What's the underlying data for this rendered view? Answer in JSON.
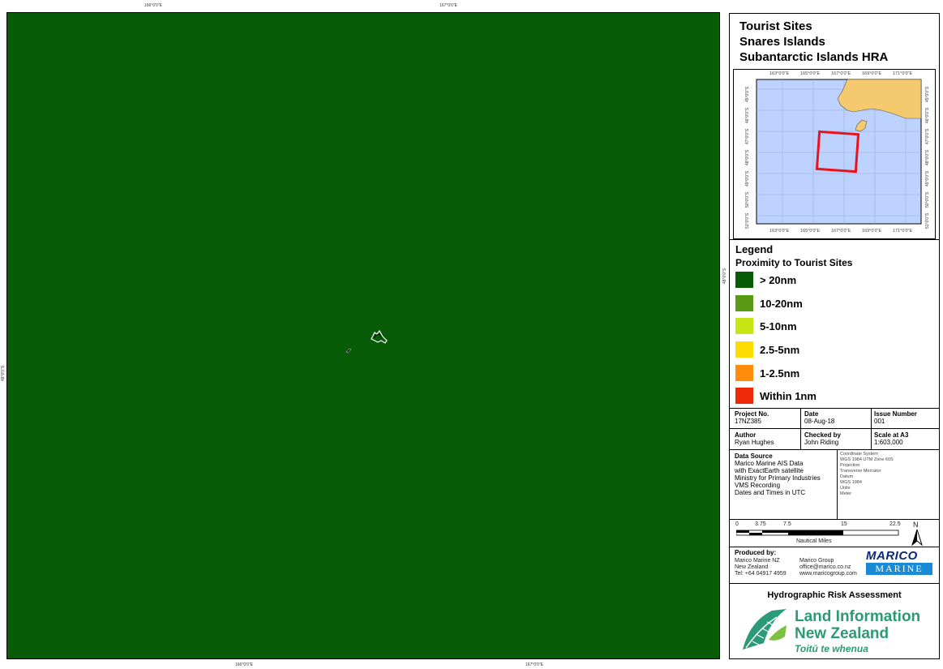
{
  "map": {
    "top_ticks": [
      "166°0'0\"E",
      "167°0'0\"E"
    ],
    "bottom_ticks": [
      "166°0'0\"E",
      "167°0'0\"E"
    ],
    "left_tick": "48°0'0\"S",
    "right_tick": "48°0'0\"S",
    "background_color": "#085c08"
  },
  "title": {
    "line1": "Tourist Sites",
    "line2": "Snares Islands",
    "line3": "Subantarctic Islands HRA"
  },
  "inset": {
    "top_ticks": [
      "163°0'0\"E",
      "165°0'0\"E",
      "167°0'0\"E",
      "169°0'0\"E",
      "171°0'0\"E"
    ],
    "bottom_ticks": [
      "163°0'0\"E",
      "165°0'0\"E",
      "167°0'0\"E",
      "169°0'0\"E",
      "171°0'0\"E"
    ],
    "left_ticks": [
      "45°0'0\"S",
      "46°0'0\"S",
      "47°0'0\"S",
      "48°0'0\"S",
      "49°0'0\"S",
      "50°0'0\"S",
      "51°0'0\"S"
    ],
    "right_ticks": [
      "45°0'0\"S",
      "46°0'0\"S",
      "47°0'0\"S",
      "48°0'0\"S",
      "49°0'0\"S",
      "50°0'0\"S",
      "51°0'0\"S"
    ],
    "sea_color": "#bed2ff",
    "land_color": "#f5c96e",
    "extent_color": "#e8141c"
  },
  "legend": {
    "title": "Legend",
    "subtitle": "Proximity to Tourist Sites",
    "items": [
      {
        "label": "> 20nm",
        "color": "#085c08"
      },
      {
        "label": "10-20nm",
        "color": "#5a9a14"
      },
      {
        "label": "5-10nm",
        "color": "#c8e614"
      },
      {
        "label": "2.5-5nm",
        "color": "#ffdc00"
      },
      {
        "label": "1-2.5nm",
        "color": "#ff8c0a"
      },
      {
        "label": "Within 1nm",
        "color": "#f0280a"
      }
    ]
  },
  "info": {
    "project_no_label": "Project No.",
    "project_no": "17NZ385",
    "date_label": "Date",
    "date": "08-Aug-18",
    "issue_label": "Issue Number",
    "issue": "001",
    "author_label": "Author",
    "author": "Ryan Hughes",
    "checked_label": "Checked by",
    "checked": "John Riding",
    "scale_label": "Scale at A3",
    "scale": "1:603,000",
    "data_source_label": "Data Source",
    "data_source_lines": [
      "Marico Marine AIS Data",
      "with ExactEarth satellite",
      "Ministry for Primary Industries",
      "VMS Recording",
      "Dates and Times in UTC"
    ],
    "coord_lines": [
      "Coordinate System",
      "WGS 1984 UTM Zone 60S",
      "Projection",
      "Transverse Mercator",
      "Datum",
      "WGS 1984",
      "Units",
      "Meter"
    ]
  },
  "scalebar": {
    "ticks": [
      "0",
      "3.75",
      "7.5",
      "15",
      "22.5"
    ],
    "units": "Nautical Miles",
    "north": "N"
  },
  "producer": {
    "label": "Produced by:",
    "col1": [
      "Marico Marine NZ",
      "New Zealand",
      "Tel: +64 04917 4959"
    ],
    "col2": [
      "Marico Group",
      "office@marico.co.nz",
      "www.maricogroup.com"
    ],
    "logo_top": "MARICO",
    "logo_bottom": "MARINE"
  },
  "footer": {
    "hra": "Hydrographic Risk Assessment",
    "linz1": "Land Information",
    "linz2": "New Zealand",
    "linz3": "Toitū te whenua"
  }
}
